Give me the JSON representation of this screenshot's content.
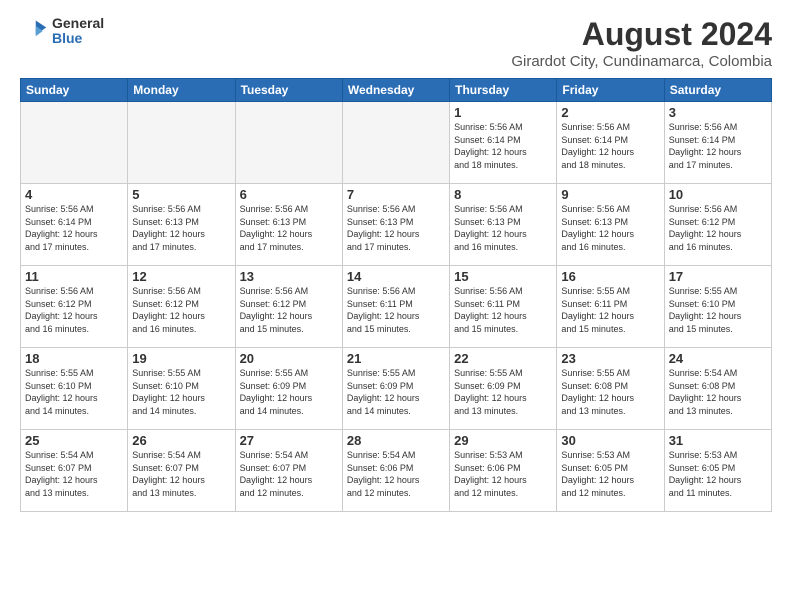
{
  "header": {
    "logo_general": "General",
    "logo_blue": "Blue",
    "title": "August 2024",
    "subtitle": "Girardot City, Cundinamarca, Colombia"
  },
  "weekdays": [
    "Sunday",
    "Monday",
    "Tuesday",
    "Wednesday",
    "Thursday",
    "Friday",
    "Saturday"
  ],
  "weeks": [
    [
      {
        "day": "",
        "empty": true
      },
      {
        "day": "",
        "empty": true
      },
      {
        "day": "",
        "empty": true
      },
      {
        "day": "",
        "empty": true
      },
      {
        "day": "1",
        "info": "Sunrise: 5:56 AM\nSunset: 6:14 PM\nDaylight: 12 hours\nand 18 minutes."
      },
      {
        "day": "2",
        "info": "Sunrise: 5:56 AM\nSunset: 6:14 PM\nDaylight: 12 hours\nand 18 minutes."
      },
      {
        "day": "3",
        "info": "Sunrise: 5:56 AM\nSunset: 6:14 PM\nDaylight: 12 hours\nand 17 minutes."
      }
    ],
    [
      {
        "day": "4",
        "info": "Sunrise: 5:56 AM\nSunset: 6:14 PM\nDaylight: 12 hours\nand 17 minutes."
      },
      {
        "day": "5",
        "info": "Sunrise: 5:56 AM\nSunset: 6:13 PM\nDaylight: 12 hours\nand 17 minutes."
      },
      {
        "day": "6",
        "info": "Sunrise: 5:56 AM\nSunset: 6:13 PM\nDaylight: 12 hours\nand 17 minutes."
      },
      {
        "day": "7",
        "info": "Sunrise: 5:56 AM\nSunset: 6:13 PM\nDaylight: 12 hours\nand 17 minutes."
      },
      {
        "day": "8",
        "info": "Sunrise: 5:56 AM\nSunset: 6:13 PM\nDaylight: 12 hours\nand 16 minutes."
      },
      {
        "day": "9",
        "info": "Sunrise: 5:56 AM\nSunset: 6:13 PM\nDaylight: 12 hours\nand 16 minutes."
      },
      {
        "day": "10",
        "info": "Sunrise: 5:56 AM\nSunset: 6:12 PM\nDaylight: 12 hours\nand 16 minutes."
      }
    ],
    [
      {
        "day": "11",
        "info": "Sunrise: 5:56 AM\nSunset: 6:12 PM\nDaylight: 12 hours\nand 16 minutes."
      },
      {
        "day": "12",
        "info": "Sunrise: 5:56 AM\nSunset: 6:12 PM\nDaylight: 12 hours\nand 16 minutes."
      },
      {
        "day": "13",
        "info": "Sunrise: 5:56 AM\nSunset: 6:12 PM\nDaylight: 12 hours\nand 15 minutes."
      },
      {
        "day": "14",
        "info": "Sunrise: 5:56 AM\nSunset: 6:11 PM\nDaylight: 12 hours\nand 15 minutes."
      },
      {
        "day": "15",
        "info": "Sunrise: 5:56 AM\nSunset: 6:11 PM\nDaylight: 12 hours\nand 15 minutes."
      },
      {
        "day": "16",
        "info": "Sunrise: 5:55 AM\nSunset: 6:11 PM\nDaylight: 12 hours\nand 15 minutes."
      },
      {
        "day": "17",
        "info": "Sunrise: 5:55 AM\nSunset: 6:10 PM\nDaylight: 12 hours\nand 15 minutes."
      }
    ],
    [
      {
        "day": "18",
        "info": "Sunrise: 5:55 AM\nSunset: 6:10 PM\nDaylight: 12 hours\nand 14 minutes."
      },
      {
        "day": "19",
        "info": "Sunrise: 5:55 AM\nSunset: 6:10 PM\nDaylight: 12 hours\nand 14 minutes."
      },
      {
        "day": "20",
        "info": "Sunrise: 5:55 AM\nSunset: 6:09 PM\nDaylight: 12 hours\nand 14 minutes."
      },
      {
        "day": "21",
        "info": "Sunrise: 5:55 AM\nSunset: 6:09 PM\nDaylight: 12 hours\nand 14 minutes."
      },
      {
        "day": "22",
        "info": "Sunrise: 5:55 AM\nSunset: 6:09 PM\nDaylight: 12 hours\nand 13 minutes."
      },
      {
        "day": "23",
        "info": "Sunrise: 5:55 AM\nSunset: 6:08 PM\nDaylight: 12 hours\nand 13 minutes."
      },
      {
        "day": "24",
        "info": "Sunrise: 5:54 AM\nSunset: 6:08 PM\nDaylight: 12 hours\nand 13 minutes."
      }
    ],
    [
      {
        "day": "25",
        "info": "Sunrise: 5:54 AM\nSunset: 6:07 PM\nDaylight: 12 hours\nand 13 minutes."
      },
      {
        "day": "26",
        "info": "Sunrise: 5:54 AM\nSunset: 6:07 PM\nDaylight: 12 hours\nand 13 minutes."
      },
      {
        "day": "27",
        "info": "Sunrise: 5:54 AM\nSunset: 6:07 PM\nDaylight: 12 hours\nand 12 minutes."
      },
      {
        "day": "28",
        "info": "Sunrise: 5:54 AM\nSunset: 6:06 PM\nDaylight: 12 hours\nand 12 minutes."
      },
      {
        "day": "29",
        "info": "Sunrise: 5:53 AM\nSunset: 6:06 PM\nDaylight: 12 hours\nand 12 minutes."
      },
      {
        "day": "30",
        "info": "Sunrise: 5:53 AM\nSunset: 6:05 PM\nDaylight: 12 hours\nand 12 minutes."
      },
      {
        "day": "31",
        "info": "Sunrise: 5:53 AM\nSunset: 6:05 PM\nDaylight: 12 hours\nand 11 minutes."
      }
    ]
  ]
}
